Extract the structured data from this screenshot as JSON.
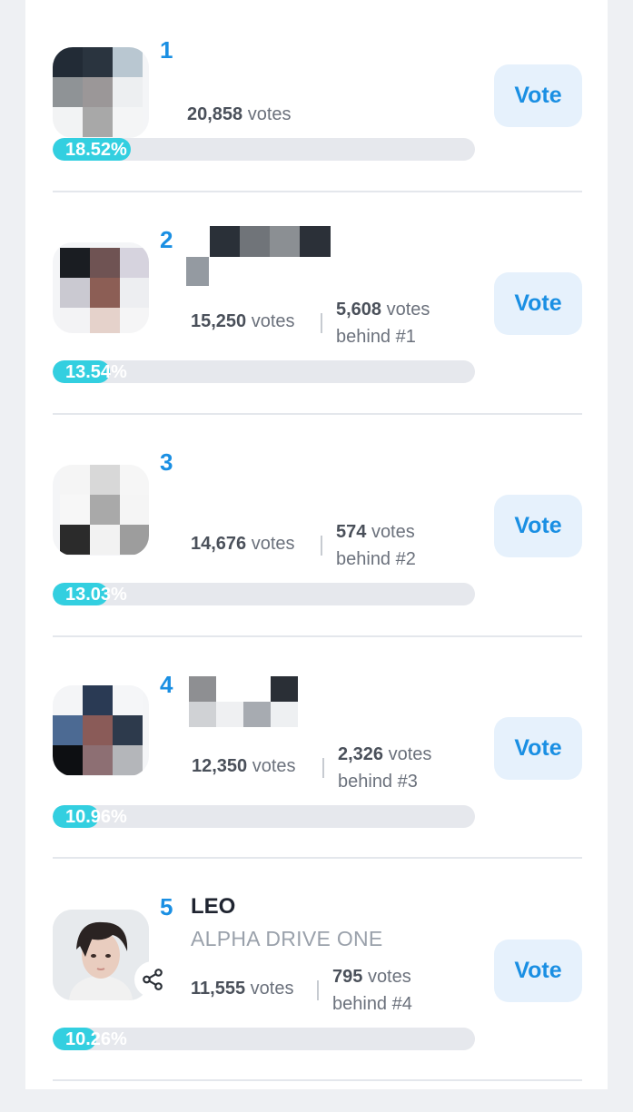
{
  "vote_label": "Vote",
  "entries": [
    {
      "rank": "1",
      "name": "",
      "group": "",
      "votes_num": "20,858",
      "votes_word": "votes",
      "behind_num": "",
      "behind_word": "",
      "behind_text": "",
      "percent_text": "18.52%",
      "percent": 18.52
    },
    {
      "rank": "2",
      "name": "",
      "group": "",
      "votes_num": "15,250",
      "votes_word": "votes",
      "behind_num": "5,608",
      "behind_word": "votes",
      "behind_text": "behind #1",
      "percent_text": "13.54%",
      "percent": 13.54
    },
    {
      "rank": "3",
      "name": "",
      "group": "",
      "votes_num": "14,676",
      "votes_word": "votes",
      "behind_num": "574",
      "behind_word": "votes",
      "behind_text": "behind #2",
      "percent_text": "13.03%",
      "percent": 13.03
    },
    {
      "rank": "4",
      "name": "",
      "group": "",
      "votes_num": "12,350",
      "votes_word": "votes",
      "behind_num": "2,326",
      "behind_word": "votes",
      "behind_text": "behind #3",
      "percent_text": "10.96%",
      "percent": 10.96
    },
    {
      "rank": "5",
      "name": "LEO",
      "group": "ALPHA DRIVE ONE",
      "votes_num": "11,555",
      "votes_word": "votes",
      "behind_num": "795",
      "behind_word": "votes",
      "behind_text": "behind #4",
      "percent_text": "10.26%",
      "percent": 10.26
    }
  ],
  "icons": {
    "share": "share-icon"
  },
  "colors": {
    "accent": "#1a8fe3",
    "progress": "#33cfe0",
    "vote_bg": "#e6f1fc"
  }
}
